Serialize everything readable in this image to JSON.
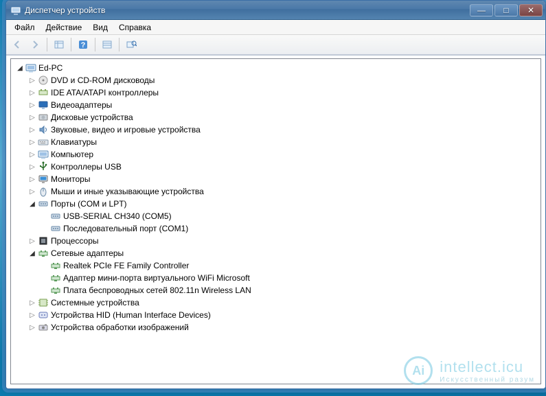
{
  "window": {
    "title": "Диспетчер устройств",
    "controls": {
      "min": "—",
      "max": "□",
      "close": "✕"
    }
  },
  "menu": [
    "Файл",
    "Действие",
    "Вид",
    "Справка"
  ],
  "toolbar": [
    {
      "name": "back",
      "label": "←"
    },
    {
      "name": "forward",
      "label": "→"
    },
    {
      "name": "show-hidden",
      "label": ""
    },
    {
      "name": "help",
      "label": "?"
    },
    {
      "name": "detail-view",
      "label": ""
    },
    {
      "name": "scan",
      "label": ""
    }
  ],
  "tree": {
    "root": {
      "label": "Ed-PC",
      "icon": "computer-icon",
      "expanded": true,
      "children": [
        {
          "label": "DVD и CD-ROM дисководы",
          "icon": "optical-icon",
          "expanded": false,
          "children": []
        },
        {
          "label": "IDE ATA/ATAPI контроллеры",
          "icon": "controller-icon",
          "expanded": false,
          "children": []
        },
        {
          "label": "Видеоадаптеры",
          "icon": "display-icon",
          "expanded": false,
          "children": []
        },
        {
          "label": "Дисковые устройства",
          "icon": "disk-icon",
          "expanded": false,
          "children": []
        },
        {
          "label": "Звуковые, видео и игровые устройства",
          "icon": "audio-icon",
          "expanded": false,
          "children": []
        },
        {
          "label": "Клавиатуры",
          "icon": "keyboard-icon",
          "expanded": false,
          "children": []
        },
        {
          "label": "Компьютер",
          "icon": "computer-icon",
          "expanded": false,
          "children": []
        },
        {
          "label": "Контроллеры USB",
          "icon": "usb-icon",
          "expanded": false,
          "children": []
        },
        {
          "label": "Мониторы",
          "icon": "monitor-icon",
          "expanded": false,
          "children": []
        },
        {
          "label": "Мыши и иные указывающие устройства",
          "icon": "mouse-icon",
          "expanded": false,
          "children": []
        },
        {
          "label": "Порты (COM и LPT)",
          "icon": "port-icon",
          "expanded": true,
          "children": [
            {
              "label": "USB-SERIAL CH340 (COM5)",
              "icon": "port-icon"
            },
            {
              "label": "Последовательный порт (COM1)",
              "icon": "port-icon"
            }
          ]
        },
        {
          "label": "Процессоры",
          "icon": "cpu-icon",
          "expanded": false,
          "children": []
        },
        {
          "label": "Сетевые адаптеры",
          "icon": "network-icon",
          "expanded": true,
          "children": [
            {
              "label": "Realtek PCIe FE Family Controller",
              "icon": "network-icon"
            },
            {
              "label": "Адаптер мини-порта виртуального WiFi Microsoft",
              "icon": "network-icon"
            },
            {
              "label": "Плата беспроводных сетей 802.11n Wireless LAN",
              "icon": "network-icon"
            }
          ]
        },
        {
          "label": "Системные устройства",
          "icon": "chip-icon",
          "expanded": false,
          "children": []
        },
        {
          "label": "Устройства HID (Human Interface Devices)",
          "icon": "hid-icon",
          "expanded": false,
          "children": []
        },
        {
          "label": "Устройства обработки изображений",
          "icon": "imaging-icon",
          "expanded": false,
          "children": []
        }
      ]
    }
  },
  "watermark": {
    "big": "intellect.icu",
    "small": "Искусственный  разум",
    "badge": "Ai"
  }
}
